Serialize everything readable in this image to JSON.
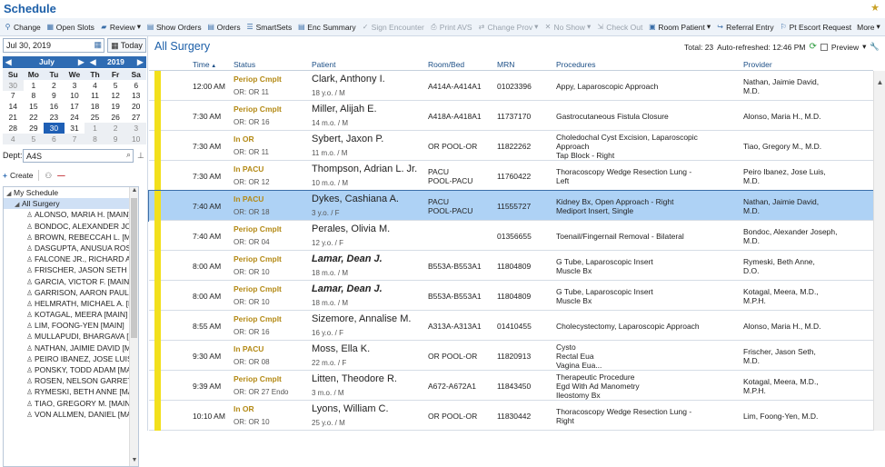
{
  "window": {
    "title": "Schedule"
  },
  "toolbar": [
    {
      "label": "Change",
      "icon": "person-change-icon",
      "enabled": true
    },
    {
      "label": "Open Slots",
      "icon": "grid-icon",
      "enabled": true
    },
    {
      "label": "Review",
      "icon": "folder-icon",
      "enabled": true,
      "dropdown": true
    },
    {
      "label": "Show Orders",
      "icon": "clipboard-icon",
      "enabled": true
    },
    {
      "label": "Orders",
      "icon": "clipboard-icon",
      "enabled": true
    },
    {
      "label": "SmartSets",
      "icon": "list-icon",
      "enabled": true
    },
    {
      "label": "Enc Summary",
      "icon": "document-icon",
      "enabled": true
    },
    {
      "label": "Sign Encounter",
      "icon": "check-icon",
      "enabled": false
    },
    {
      "label": "Print AVS",
      "icon": "print-icon",
      "enabled": false
    },
    {
      "label": "Change Prov",
      "icon": "swap-icon",
      "enabled": false,
      "dropdown": true
    },
    {
      "label": "No Show",
      "icon": "x-icon",
      "enabled": false,
      "dropdown": true
    },
    {
      "label": "Check Out",
      "icon": "door-icon",
      "enabled": false
    },
    {
      "label": "Room Patient",
      "icon": "room-icon",
      "enabled": true,
      "dropdown": true
    },
    {
      "label": "Referral Entry",
      "icon": "referral-icon",
      "enabled": true
    },
    {
      "label": "Pt Escort Request",
      "icon": "escort-icon",
      "enabled": true
    },
    {
      "label": "More",
      "icon": "",
      "enabled": true,
      "dropdown": true
    }
  ],
  "left": {
    "date": "Jul 30, 2019",
    "today_label": "Today",
    "calendar": {
      "month": "July",
      "year": "2019",
      "weekdays": [
        "Su",
        "Mo",
        "Tu",
        "We",
        "Th",
        "Fr",
        "Sa"
      ],
      "weeks": [
        [
          "30",
          "1",
          "2",
          "3",
          "4",
          "5",
          "6"
        ],
        [
          "7",
          "8",
          "9",
          "10",
          "11",
          "12",
          "13"
        ],
        [
          "14",
          "15",
          "16",
          "17",
          "18",
          "19",
          "20"
        ],
        [
          "21",
          "22",
          "23",
          "24",
          "25",
          "26",
          "27"
        ],
        [
          "28",
          "29",
          "30",
          "31",
          "1",
          "2",
          "3"
        ],
        [
          "4",
          "5",
          "6",
          "7",
          "8",
          "9",
          "10"
        ]
      ],
      "selected": "30"
    },
    "dept_label": "Dept:",
    "dept_value": "A4S",
    "create_label": "Create",
    "tree": {
      "root": "My Schedule",
      "group": "All Surgery",
      "providers": [
        "ALONSO, MARIA H. [MAIN]",
        "BONDOC, ALEXANDER JOS",
        "BROWN, REBECCAH L. [MA",
        "DASGUPTA, ANUSUA ROS",
        "FALCONE JR., RICHARD A.",
        "FRISCHER, JASON SETH [I",
        "GARCIA, VICTOR F. [MAIN]",
        "GARRISON, AARON PAUL [",
        "HELMRATH, MICHAEL A. [N",
        "KOTAGAL, MEERA [MAIN]",
        "LIM, FOONG-YEN [MAIN]",
        "MULLAPUDI, BHARGAVA [I",
        "NATHAN, JAIMIE DAVID [M",
        "PEIRO IBANEZ, JOSE LUIS",
        "PONSKY, TODD ADAM [MA",
        "ROSEN, NELSON GARRET",
        "RYMESKI, BETH ANNE [MA",
        "TIAO, GREGORY M. [MAIN",
        "VON ALLMEN, DANIEL [MA"
      ]
    }
  },
  "main": {
    "title": "All Surgery",
    "total": "Total: 23",
    "refreshed": "Auto-refreshed: 12:46 PM",
    "preview_label": "Preview",
    "columns": [
      "Time",
      "Status",
      "Patient",
      "Room/Bed",
      "MRN",
      "Procedures",
      "Provider"
    ],
    "rows": [
      {
        "time": "12:00 AM",
        "status": "Periop Cmplt",
        "loc": "OR: OR 11",
        "patient": "Clark, Anthony I.",
        "age": "18 y.o. / M",
        "room": [
          "A414A-A414A1"
        ],
        "mrn": "01023396",
        "procs": [
          "Appy, Laparoscopic Approach"
        ],
        "provider": [
          "Nathan, Jaimie David,",
          "M.D."
        ],
        "bold": false,
        "selected": false
      },
      {
        "time": "7:30 AM",
        "status": "Periop Cmplt",
        "loc": "OR: OR 16",
        "patient": "Miller, Alijah E.",
        "age": "14 m.o. / M",
        "room": [
          "A418A-A418A1"
        ],
        "mrn": "11737170",
        "procs": [
          "Gastrocutaneous Fistula Closure"
        ],
        "provider": [
          "Alonso, Maria H., M.D."
        ],
        "bold": false,
        "selected": false
      },
      {
        "time": "7:30 AM",
        "status": "In OR",
        "loc": "OR: OR 11",
        "patient": "Sybert, Jaxon P.",
        "age": "11 m.o. / M",
        "room": [
          "OR POOL-OR"
        ],
        "mrn": "11822262",
        "procs": [
          "Choledochal Cyst Excision, Laparoscopic",
          "Approach",
          "Tap Block - Right"
        ],
        "provider": [
          "Tiao, Gregory M., M.D."
        ],
        "bold": false,
        "selected": false
      },
      {
        "time": "7:30 AM",
        "status": "In PACU",
        "loc": "OR: OR 12",
        "patient": "Thompson, Adrian L. Jr.",
        "age": "10 m.o. / M",
        "room": [
          "PACU",
          "POOL-PACU"
        ],
        "mrn": "11760422",
        "procs": [
          "Thoracoscopy Wedge Resection Lung -",
          "Left"
        ],
        "provider": [
          "Peiro Ibanez, Jose Luis,",
          "M.D."
        ],
        "bold": false,
        "selected": false
      },
      {
        "time": "7:40 AM",
        "status": "In PACU",
        "loc": "OR: OR 18",
        "patient": "Dykes, Cashiana A.",
        "age": "3 y.o. / F",
        "room": [
          "PACU",
          "POOL-PACU"
        ],
        "mrn": "11555727",
        "procs": [
          "Kidney Bx, Open Approach - Right",
          "Mediport Insert, Single"
        ],
        "provider": [
          "Nathan, Jaimie David,",
          "M.D."
        ],
        "bold": false,
        "selected": true
      },
      {
        "time": "7:40 AM",
        "status": "Periop Cmplt",
        "loc": "OR: OR 04",
        "patient": "Perales, Olivia M.",
        "age": "12 y.o. / F",
        "room": [],
        "mrn": "01356655",
        "procs": [
          "Toenail/Fingernail Removal - Bilateral"
        ],
        "provider": [
          "Bondoc, Alexander Joseph,",
          "M.D."
        ],
        "bold": false,
        "selected": false
      },
      {
        "time": "8:00 AM",
        "status": "Periop Cmplt",
        "loc": "OR: OR 10",
        "patient": "Lamar, Dean J.",
        "age": "18 m.o. / M",
        "room": [
          "B553A-B553A1"
        ],
        "mrn": "11804809",
        "procs": [
          "G Tube, Laparoscopic Insert",
          "Muscle Bx"
        ],
        "provider": [
          "Rymeski, Beth Anne,",
          "D.O."
        ],
        "bold": true,
        "selected": false
      },
      {
        "time": "8:00 AM",
        "status": "Periop Cmplt",
        "loc": "OR: OR 10",
        "patient": "Lamar, Dean J.",
        "age": "18 m.o. / M",
        "room": [
          "B553A-B553A1"
        ],
        "mrn": "11804809",
        "procs": [
          "G Tube, Laparoscopic Insert",
          "Muscle Bx"
        ],
        "provider": [
          "Kotagal, Meera, M.D.,",
          "M.P.H."
        ],
        "bold": true,
        "selected": false
      },
      {
        "time": "8:55 AM",
        "status": "Periop Cmplt",
        "loc": "OR: OR 16",
        "patient": "Sizemore, Annalise M.",
        "age": "16 y.o. / F",
        "room": [
          "A313A-A313A1"
        ],
        "mrn": "01410455",
        "procs": [
          "Cholecystectomy, Laparoscopic Approach"
        ],
        "provider": [
          "Alonso, Maria H., M.D."
        ],
        "bold": false,
        "selected": false
      },
      {
        "time": "9:30 AM",
        "status": "In PACU",
        "loc": "OR: OR 08",
        "patient": "Moss, Ella K.",
        "age": "22 m.o. / F",
        "room": [
          "OR POOL-OR"
        ],
        "mrn": "11820913",
        "procs": [
          "Cysto",
          "Rectal Eua",
          "Vagina Eua..."
        ],
        "provider": [
          "Frischer, Jason Seth,",
          "M.D."
        ],
        "bold": false,
        "selected": false
      },
      {
        "time": "9:39 AM",
        "status": "Periop Cmplt",
        "loc": "OR: OR 27 Endo",
        "patient": "Litten, Theodore R.",
        "age": "3 m.o. / M",
        "room": [
          "A672-A672A1"
        ],
        "mrn": "11843450",
        "procs": [
          "Therapeutic Procedure",
          "Egd With Ad Manometry",
          "Ileostomy Bx"
        ],
        "provider": [
          "Kotagal, Meera, M.D.,",
          "M.P.H."
        ],
        "bold": false,
        "selected": false
      },
      {
        "time": "10:10 AM",
        "status": "In OR",
        "loc": "OR: OR 10",
        "patient": "Lyons, William C.",
        "age": "25 y.o. / M",
        "room": [
          "OR POOL-OR"
        ],
        "mrn": "11830442",
        "procs": [
          "Thoracoscopy Wedge Resection Lung -",
          "Right"
        ],
        "provider": [
          "Lim, Foong-Yen, M.D."
        ],
        "bold": false,
        "selected": false
      }
    ]
  }
}
